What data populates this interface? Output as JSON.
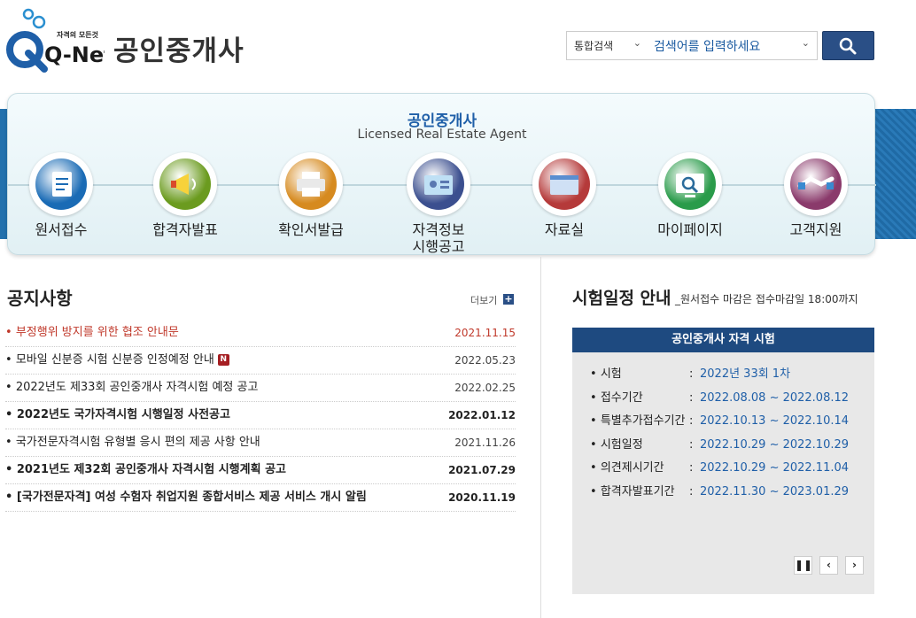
{
  "header": {
    "logo_tagline": "자격의 모든것",
    "logo_text": "Q-Net",
    "title": "공인중개사",
    "search_scope": "통합검색",
    "search_placeholder": "검색어를 입력하세요"
  },
  "banner": {
    "title": "공인중개사",
    "subtitle": "Licensed Real Estate Agent",
    "menu": [
      {
        "label": "원서접수",
        "icon": "document-icon",
        "color": "#1a6bb5"
      },
      {
        "label": "합격자발표",
        "icon": "megaphone-icon",
        "color": "#6b9b1f"
      },
      {
        "label": "확인서발급",
        "icon": "printer-icon",
        "color": "#d68a1f"
      },
      {
        "label": "자격정보\n시행공고",
        "icon": "id-card-icon",
        "color": "#3b4f8f"
      },
      {
        "label": "자료실",
        "icon": "folder-icon",
        "color": "#b53a3a"
      },
      {
        "label": "마이페이지",
        "icon": "monitor-search-icon",
        "color": "#2a9b4a"
      },
      {
        "label": "고객지원",
        "icon": "handshake-icon",
        "color": "#8a3a6b"
      }
    ]
  },
  "notices": {
    "heading": "공지사항",
    "more_label": "더보기",
    "items": [
      {
        "title": "부정행위 방지를 위한 협조 안내문",
        "date": "2021.11.15",
        "style": "red",
        "new": false
      },
      {
        "title": "모바일 신분증 시험 신분증 인정예정 안내",
        "date": "2022.05.23",
        "style": "normal",
        "new": true
      },
      {
        "title": "2022년도 제33회 공인중개사 자격시험 예정 공고",
        "date": "2022.02.25",
        "style": "normal",
        "new": false
      },
      {
        "title": "2022년도 국가자격시험 시행일정 사전공고",
        "date": "2022.01.12",
        "style": "bold",
        "new": false
      },
      {
        "title": "국가전문자격시험 유형별 응시 편의 제공 사항 안내",
        "date": "2021.11.26",
        "style": "normal",
        "new": false
      },
      {
        "title": "2021년도 제32회 공인중개사 자격시험 시행계획 공고",
        "date": "2021.07.29",
        "style": "bold",
        "new": false
      },
      {
        "title": "[국가전문자격] 여성 수험자 취업지원 종합서비스 제공 서비스 개시 알림",
        "date": "2020.11.19",
        "style": "bold",
        "new": false
      }
    ],
    "new_badge": "N"
  },
  "schedule": {
    "heading": "시험일정 안내",
    "note": "_원서접수 마감은 접수마감일 18:00까지",
    "box_title": "공인중개사 자격 시험",
    "rows": [
      {
        "key": "시험",
        "value": "2022년 33회 1차"
      },
      {
        "key": "접수기간",
        "value": "2022.08.08 ~ 2022.08.12"
      },
      {
        "key": "특별추가접수기간",
        "value": "2022.10.13 ~ 2022.10.14"
      },
      {
        "key": "시험일정",
        "value": "2022.10.29 ~ 2022.10.29"
      },
      {
        "key": "의견제시기간",
        "value": "2022.10.29 ~ 2022.11.04"
      },
      {
        "key": "합격자발표기간",
        "value": "2022.11.30 ~ 2023.01.29"
      }
    ],
    "controls": {
      "pause": "pause-icon",
      "prev": "chevron-left-icon",
      "next": "chevron-right-icon"
    }
  }
}
